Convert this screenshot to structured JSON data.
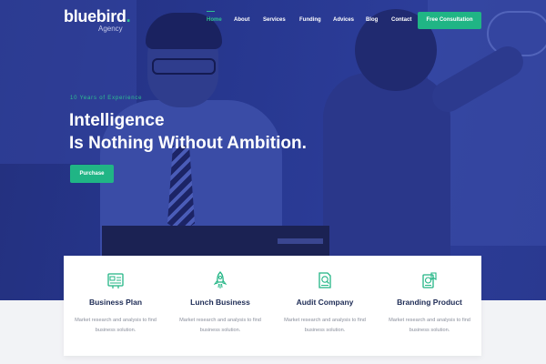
{
  "brand": {
    "name_main": "bluebird",
    "name_dot": ".",
    "sub": "Agency",
    "accent_color": "#2ec191"
  },
  "nav": {
    "items": [
      {
        "label": "Home",
        "active": true
      },
      {
        "label": "About",
        "active": false
      },
      {
        "label": "Services",
        "active": false
      },
      {
        "label": "Funding",
        "active": false
      },
      {
        "label": "Advices",
        "active": false
      },
      {
        "label": "Blog",
        "active": false
      },
      {
        "label": "Contact",
        "active": false
      }
    ],
    "cta_label": "Free Consultation"
  },
  "hero": {
    "kicker": "10 Years of Experience",
    "headline_line1": "Intelligence",
    "headline_line2": "Is Nothing Without Ambition.",
    "button_label": "Purchase",
    "overlay_color": "#27378f"
  },
  "features": [
    {
      "icon": "business-plan-icon",
      "title": "Business Plan",
      "desc": "Market research and analysis to find business solution."
    },
    {
      "icon": "rocket-icon",
      "title": "Lunch Business",
      "desc": "Market research and analysis to find business solution."
    },
    {
      "icon": "audit-document-icon",
      "title": "Audit Company",
      "desc": "Market research and analysis to find business solution."
    },
    {
      "icon": "branding-icon",
      "title": "Branding Product",
      "desc": "Market research and analysis to find business solution."
    }
  ]
}
